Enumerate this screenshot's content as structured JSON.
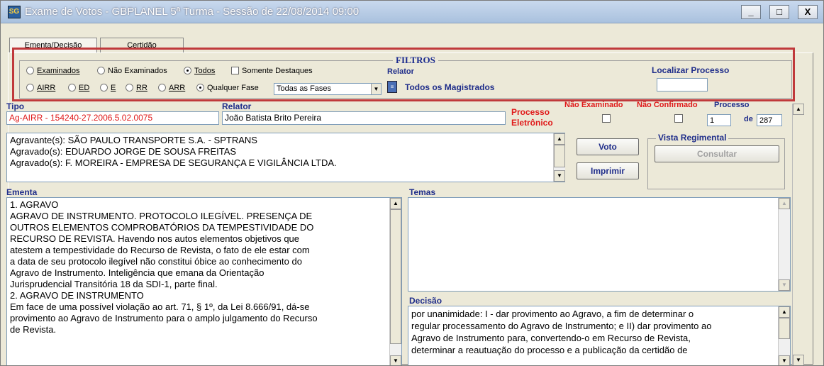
{
  "window": {
    "title": "Exame de Votos - GBPLANEL 5ª Turma - Sessão de 22/08/2014 09:00",
    "app_icon_text": "SG",
    "controls": {
      "minimize": "_",
      "maximize": "□",
      "close": "X"
    }
  },
  "tabs": [
    {
      "label": "Ementa/Decisão",
      "active": true
    },
    {
      "label": "Certidão",
      "active": false
    }
  ],
  "filtros": {
    "title": "FILTROS",
    "exam_options": [
      {
        "label": "Examinados",
        "checked": false
      },
      {
        "label": "Não Examinados",
        "checked": false
      },
      {
        "label": "Todos",
        "checked": true
      }
    ],
    "somente_destaques": {
      "label": "Somente Destaques",
      "checked": false
    },
    "fase_options": [
      {
        "label": "AIRR",
        "checked": false
      },
      {
        "label": "ED",
        "checked": false
      },
      {
        "label": "E",
        "checked": false
      },
      {
        "label": "RR",
        "checked": false
      },
      {
        "label": "ARR",
        "checked": false
      },
      {
        "label": "Qualquer Fase",
        "checked": true
      }
    ],
    "fase_select": "Todas as Fases",
    "relator_label": "Relator",
    "relator_value": "Todos os Magistrados",
    "localizar_label": "Localizar Processo",
    "localizar_value": ""
  },
  "processo": {
    "tipo_label": "Tipo",
    "tipo_value": "Ag-AIRR - 154240-27.2006.5.02.0075",
    "relator_label": "Relator",
    "relator_value": "João Batista Brito Pereira",
    "eletronico_line1": "Processo",
    "eletronico_line2": "Eletrônico",
    "nao_examinado_label": "Não Examinado",
    "nao_confirmado_label": "Não Confirmado",
    "processo_label": "Processo",
    "processo_num": "1",
    "de_label": "de",
    "total": "287"
  },
  "partes": [
    "Agravante(s): SÃO PAULO TRANSPORTE S.A. - SPTRANS",
    "Agravado(s): EDUARDO JORGE DE SOUSA FREITAS",
    "Agravado(s): F. MOREIRA - EMPRESA DE SEGURANÇA E VIGILÂNCIA LTDA."
  ],
  "buttons": {
    "voto": "Voto",
    "imprimir": "Imprimir",
    "consultar": "Consultar"
  },
  "vista_regimental_label": "Vista Regimental",
  "ementa": {
    "label": "Ementa",
    "lines": [
      "1. AGRAVO",
      "AGRAVO DE INSTRUMENTO. PROTOCOLO ILEGÍVEL. PRESENÇA DE",
      "OUTROS ELEMENTOS COMPROBATÓRIOS DA TEMPESTIVIDADE DO",
      "RECURSO DE REVISTA. Havendo nos autos elementos objetivos que",
      "atestem a tempestividade do Recurso de Revista, o fato de ele estar com",
      "a data de seu protocolo ilegível não constitui óbice ao conhecimento do",
      "Agravo de Instrumento. Inteligência que emana da Orientação",
      "Jurisprudencial Transitória 18 da SDI-1, parte final.",
      "2. AGRAVO DE INSTRUMENTO",
      "Em face de uma possível violação ao art. 71, § 1º, da Lei 8.666/91, dá-se",
      "provimento ao Agravo de Instrumento para o amplo julgamento do Recurso",
      "de Revista."
    ]
  },
  "temas": {
    "label": "Temas"
  },
  "decisao": {
    "label": "Decisão",
    "lines": [
      "por unanimidade: I - dar provimento ao Agravo, a fim de determinar o",
      "regular processamento do Agravo de Instrumento; e II) dar provimento ao",
      "Agravo de Instrumento para, convertendo-o em Recurso de Revista,",
      "determinar a reautuação do processo e a publicação da certidão de"
    ]
  }
}
